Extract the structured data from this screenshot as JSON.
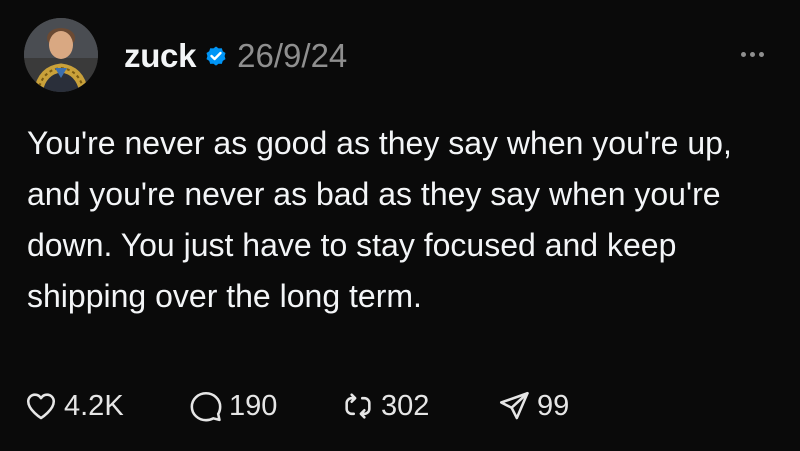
{
  "post": {
    "author": {
      "username": "zuck",
      "verified": true,
      "avatar_icon": "profile-photo"
    },
    "timestamp": "26/9/24",
    "text": "You're never as good as they say when you're up, and you're never as bad as they say when you're down. You just have to stay focused and keep shipping over the long term.",
    "actions": {
      "likes": "4.2K",
      "replies": "190",
      "reposts": "302",
      "shares": "99"
    }
  },
  "colors": {
    "background": "#0a0a0a",
    "text": "#f3f5f7",
    "muted": "#8f8f8f",
    "verified_badge": "#0095f6"
  },
  "icons": {
    "like": "heart-icon",
    "reply": "comment-bubble-icon",
    "repost": "repost-icon",
    "share": "send-icon",
    "more": "more-options-icon",
    "verified": "verified-badge-icon"
  }
}
